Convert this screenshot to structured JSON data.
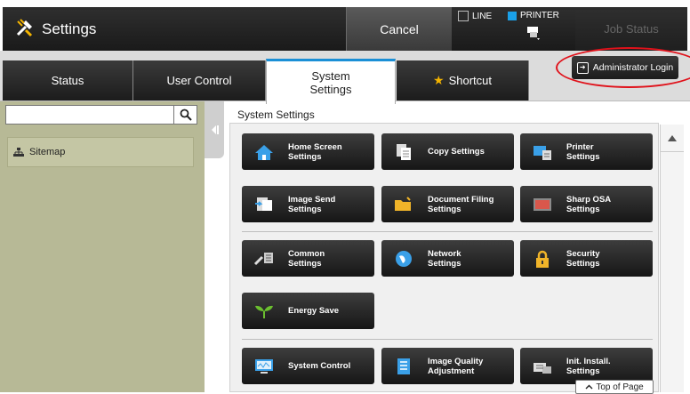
{
  "header": {
    "title": "Settings",
    "cancel_label": "Cancel",
    "line_label": "LINE",
    "printer_label": "PRINTER",
    "job_status_label": "Job Status"
  },
  "tabs": [
    {
      "label": "Status",
      "active": false
    },
    {
      "label": "User Control",
      "active": false
    },
    {
      "label": "System\nSettings",
      "active": true
    },
    {
      "label": "Shortcut",
      "active": false
    }
  ],
  "admin_login_label": "Administrator Login",
  "sidebar": {
    "search_placeholder": "",
    "items": [
      {
        "label": "Sitemap"
      }
    ]
  },
  "main": {
    "title": "System Settings",
    "tiles": [
      {
        "label": "Home Screen\nSettings",
        "icon": "home-icon"
      },
      {
        "label": "Copy Settings",
        "icon": "copy-icon"
      },
      {
        "label": "Printer\nSettings",
        "icon": "printer-icon"
      },
      {
        "label": "Image Send\nSettings",
        "icon": "image-send-icon"
      },
      {
        "label": "Document Filing\nSettings",
        "icon": "folder-icon"
      },
      {
        "label": "Sharp OSA\nSettings",
        "icon": "osa-icon"
      },
      {
        "label": "Common\nSettings",
        "icon": "tools-icon"
      },
      {
        "label": "Network\nSettings",
        "icon": "globe-icon"
      },
      {
        "label": "Security\nSettings",
        "icon": "lock-icon"
      },
      {
        "label": "Energy Save",
        "icon": "leaf-icon"
      },
      {
        "label": "System Control",
        "icon": "monitor-icon"
      },
      {
        "label": "Image Quality\nAdjustment",
        "icon": "image-quality-icon"
      },
      {
        "label": "Init. Install.\nSettings",
        "icon": "install-icon"
      }
    ],
    "top_of_page_label": "Top of Page"
  },
  "colors": {
    "accent": "#1a8fd6",
    "sidebar_bg": "#b7b996",
    "highlight_oval": "#e0121b"
  }
}
